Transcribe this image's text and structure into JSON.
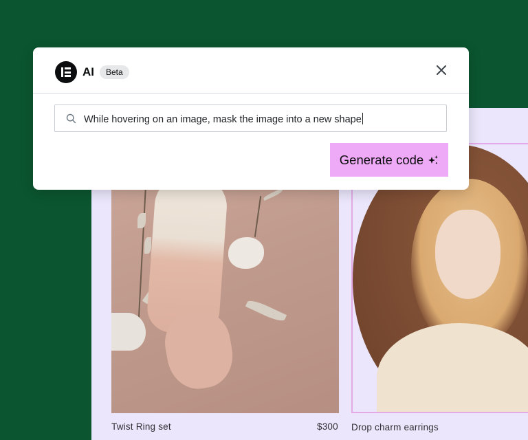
{
  "dialog": {
    "title": "AI",
    "badge": "Beta",
    "close_icon": "close-icon",
    "prompt": {
      "value": "While hovering on an image, mask the image into a new shape",
      "icon": "search-icon"
    },
    "generate_label": "Generate code",
    "generate_icon": "sparkle-icon",
    "accent_color": "#eeaaf6"
  },
  "products": [
    {
      "name": "Twist Ring set",
      "price": "$300"
    },
    {
      "name": "Drop charm earrings"
    }
  ],
  "colors": {
    "background": "#0b5530",
    "panel": "#ebe6fb",
    "mask_border": "#e3a9e9"
  }
}
